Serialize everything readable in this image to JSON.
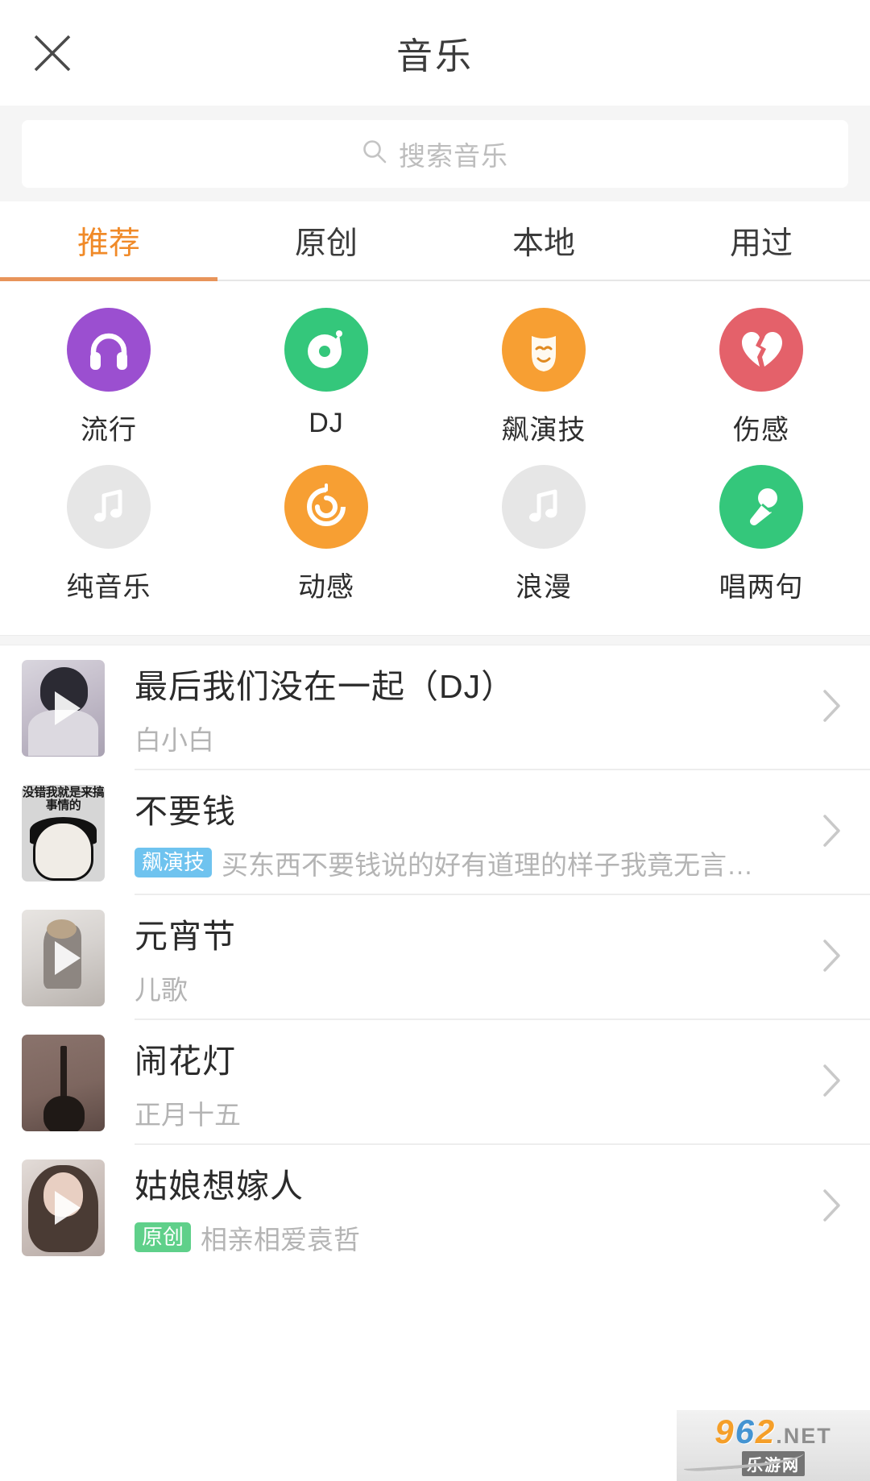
{
  "header": {
    "title": "音乐",
    "close_icon": "close-icon"
  },
  "search": {
    "placeholder": "搜索音乐",
    "value": "",
    "icon": "search-icon"
  },
  "tabs": [
    {
      "label": "推荐",
      "active": true
    },
    {
      "label": "原创",
      "active": false
    },
    {
      "label": "本地",
      "active": false
    },
    {
      "label": "用过",
      "active": false
    }
  ],
  "categories": [
    {
      "label": "流行",
      "icon": "headphones-icon",
      "color": "#9b4fd0"
    },
    {
      "label": "DJ",
      "icon": "vinyl-record-icon",
      "color": "#34c77b"
    },
    {
      "label": "飙演技",
      "icon": "theater-mask-icon",
      "color": "#f79f33"
    },
    {
      "label": "伤感",
      "icon": "broken-heart-icon",
      "color": "#e4616a"
    },
    {
      "label": "纯音乐",
      "icon": "music-note-icon",
      "color": "#e6e6e6"
    },
    {
      "label": "动感",
      "icon": "swirl-icon",
      "color": "#f79f33"
    },
    {
      "label": "浪漫",
      "icon": "music-note-icon",
      "color": "#e6e6e6"
    },
    {
      "label": "唱两句",
      "icon": "microphone-icon",
      "color": "#34c77b"
    }
  ],
  "songs": [
    {
      "title": "最后我们没在一起（DJ）",
      "tag": "",
      "artist": "白小白",
      "thumb_text": "",
      "has_play": true
    },
    {
      "title": "不要钱",
      "tag": "飙演技",
      "tag_color": "blue",
      "artist": "买东西不要钱说的好有道理的样子我竟无言…",
      "thumb_text": "没错我就是来搞事情的",
      "has_play": false
    },
    {
      "title": "元宵节",
      "tag": "",
      "artist": "儿歌",
      "thumb_text": "",
      "has_play": true
    },
    {
      "title": "闹花灯",
      "tag": "",
      "artist": "正月十五",
      "thumb_text": "",
      "has_play": false
    },
    {
      "title": "姑娘想嫁人",
      "tag": "原创",
      "tag_color": "green",
      "artist": "相亲相爱袁哲",
      "thumb_text": "",
      "has_play": true
    }
  ],
  "watermark": {
    "digits_9": "9",
    "digits_6": "6",
    "digits_2": "2",
    "dot_net": ".NET",
    "cn": "乐游网"
  }
}
